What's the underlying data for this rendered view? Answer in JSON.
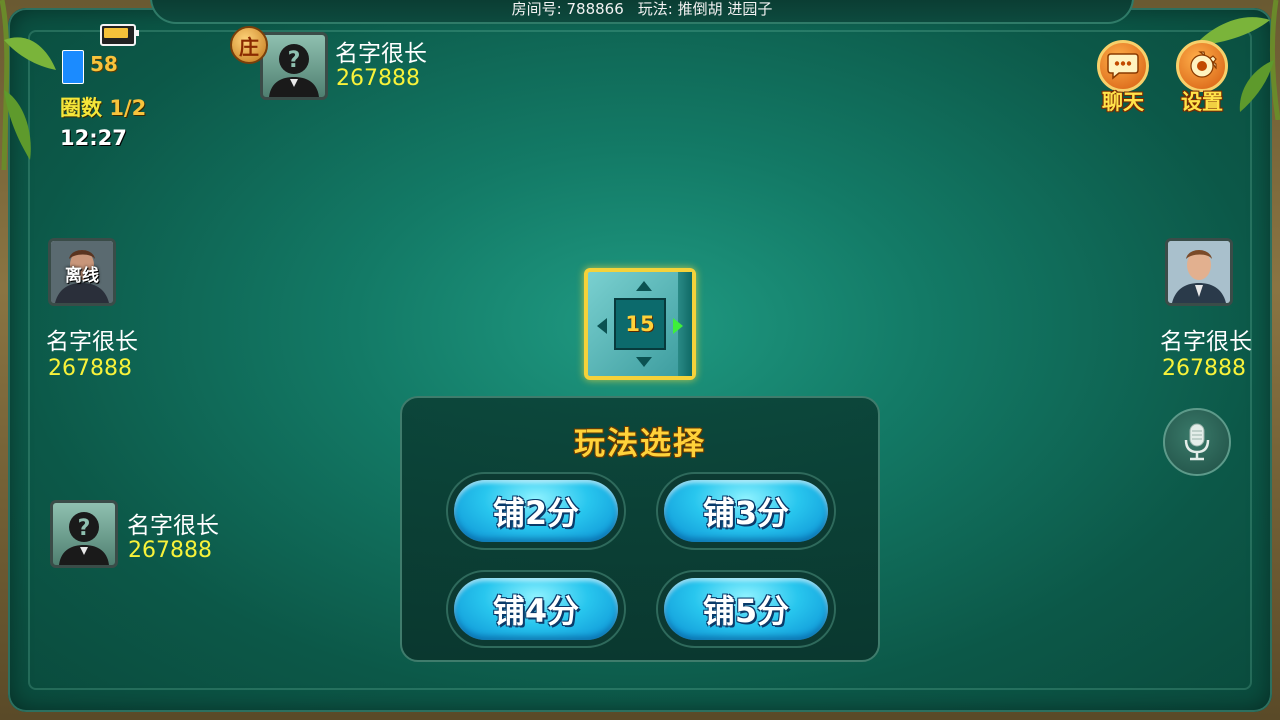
{
  "header": {
    "room_label": "房间号: 788866",
    "rule_label": "玩法: 推倒胡 进园子"
  },
  "status": {
    "signal": "58",
    "round_key": "圈数",
    "round_value": "1/2",
    "clock": "12:27"
  },
  "players": {
    "top": {
      "name": "名字很长",
      "score": "267888",
      "dealer_badge": "庄"
    },
    "left": {
      "name": "名字很长",
      "score": "267888",
      "offline": "离线"
    },
    "right": {
      "name": "名字很长",
      "score": "267888"
    },
    "bottom": {
      "name": "名字很长",
      "score": "267888"
    }
  },
  "buttons": {
    "chat": "聊天",
    "settings": "设置"
  },
  "compass": {
    "timer": "15"
  },
  "panel": {
    "title": "玩法选择",
    "options": [
      "铺2分",
      "铺3分",
      "铺4分",
      "铺5分"
    ]
  },
  "colors": {
    "table": "#137a66",
    "gold": "#ffd23a",
    "score_yellow": "#f8f23a",
    "pill_blue": "#28c6ee"
  }
}
